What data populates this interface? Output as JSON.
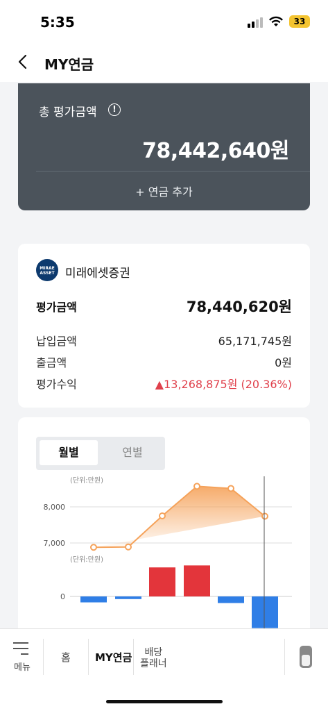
{
  "status_bar": {
    "time": "5:35",
    "battery": "33"
  },
  "header": {
    "title": "MY연금"
  },
  "total": {
    "label": "총 평가금액",
    "value": "78,442,640원",
    "add_label": "+ 연금 추가"
  },
  "broker": {
    "logo_text_1": "MIRAE",
    "logo_text_2": "ASSET",
    "name": "미래에셋증권",
    "rows": [
      {
        "label": "평가금액",
        "value": "78,440,620원"
      },
      {
        "label": "납입금액",
        "value": "65,171,745원"
      },
      {
        "label": "출금액",
        "value": "0원"
      },
      {
        "label": "평가수익",
        "value": "▲13,268,875원 (20.36%)"
      }
    ]
  },
  "chart_tabs": {
    "monthly": "월별",
    "yearly": "연별"
  },
  "chart_data": {
    "type": "line+bar",
    "line": {
      "unit_label": "(단위:만원)",
      "y_ticks": [
        "8,000",
        "7,000"
      ],
      "values": [
        6880,
        6890,
        7750,
        8570,
        8510,
        7740
      ]
    },
    "bars": {
      "unit_label": "(단위:만원)",
      "y_ticks": [
        "0"
      ],
      "values": [
        -90,
        -40,
        440,
        470,
        -100,
        -480
      ]
    }
  },
  "colors": {
    "line": "#f5a25a",
    "bar_pos": "#e3353b",
    "bar_neg": "#2f7ee6"
  },
  "nav": {
    "menu": "메뉴",
    "home": "홈",
    "my_pension": "MY연금",
    "dividend_1": "배당",
    "dividend_2": "플래너"
  }
}
